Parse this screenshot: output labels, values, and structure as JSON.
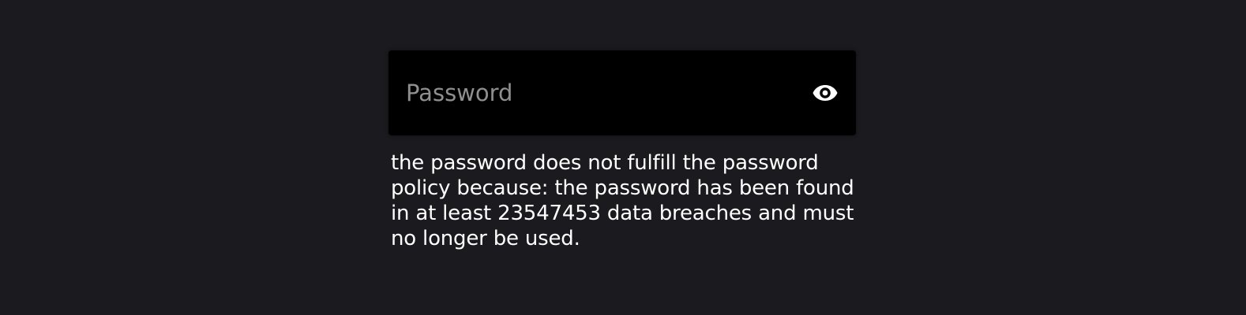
{
  "password_field": {
    "placeholder": "Password",
    "value": "",
    "visibility_toggle_icon": "eye-icon"
  },
  "error": {
    "message": "the password does not fulfill the password policy because: the password has been found in at least 23547453 data breaches and must no longer be used."
  },
  "colors": {
    "page_background": "#1b1b1f",
    "field_background": "#000000",
    "placeholder_text": "#8f8f8f",
    "message_text": "#ffffff"
  }
}
